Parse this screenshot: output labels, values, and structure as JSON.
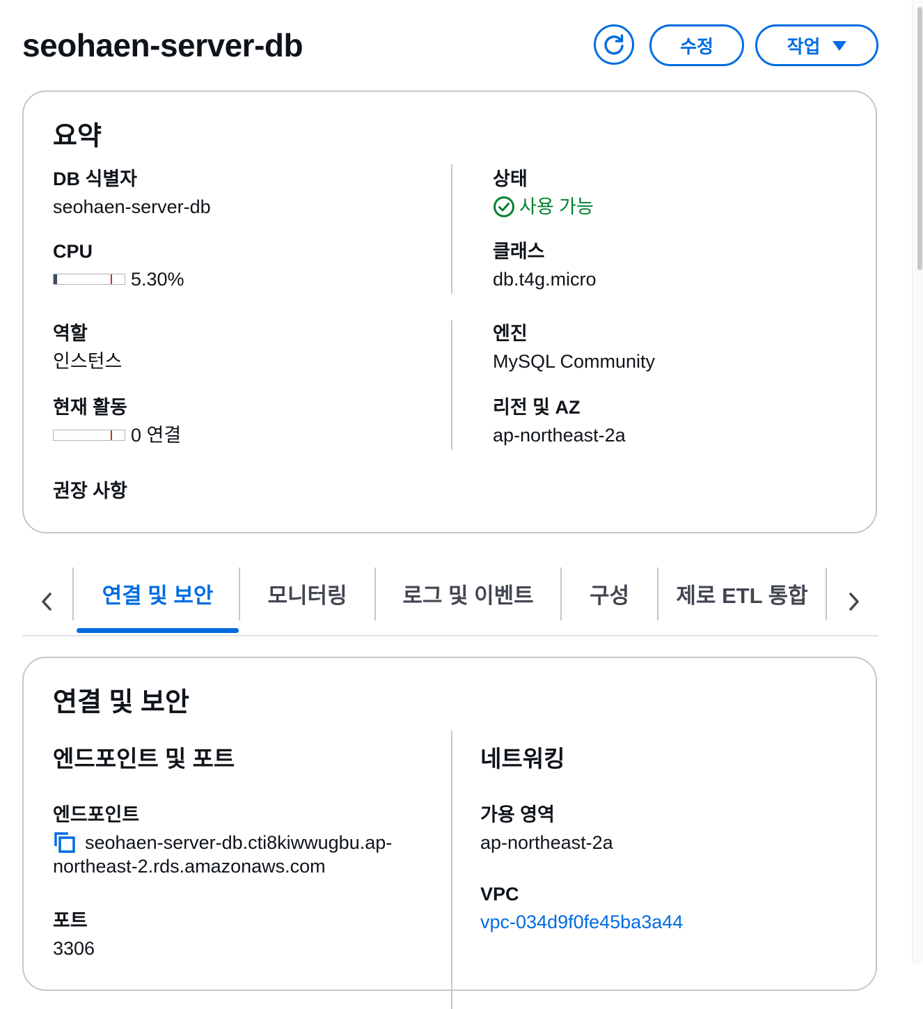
{
  "header": {
    "title": "seohaen-server-db",
    "refresh_icon": "refresh-icon",
    "edit_label": "수정",
    "actions_label": "작업",
    "accent_color": "#006ce0"
  },
  "summary": {
    "title": "요약",
    "db_identifier": {
      "label": "DB 식별자",
      "value": "seohaen-server-db"
    },
    "cpu": {
      "label": "CPU",
      "value": "5.30%",
      "fraction": 0.053
    },
    "role": {
      "label": "역할",
      "value": "인스턴스"
    },
    "activity": {
      "label": "현재 활동",
      "value": "0 연결",
      "fraction": 0
    },
    "recommendations": {
      "label": "권장 사항"
    },
    "status": {
      "label": "상태",
      "value": "사용 가능",
      "color": "#00802f",
      "icon": "check-circle-icon"
    },
    "class": {
      "label": "클래스",
      "value": "db.t4g.micro"
    },
    "engine": {
      "label": "엔진",
      "value": "MySQL Community"
    },
    "region": {
      "label": "리전 및 AZ",
      "value": "ap-northeast-2a"
    }
  },
  "tabs": {
    "items": [
      "연결 및 보안",
      "모니터링",
      "로그 및 이벤트",
      "구성",
      "제로 ETL 통합"
    ],
    "active_index": 0
  },
  "connectivity": {
    "title": "연결 및 보안",
    "endpoint_section": "엔드포인트 및 포트",
    "endpoint": {
      "label": "엔드포인트",
      "line1": "seohaen-server-db.cti8kiwwugbu.ap-",
      "line2": "northeast-2.rds.amazonaws.com",
      "icon": "copy-icon"
    },
    "port": {
      "label": "포트",
      "value": "3306"
    },
    "networking_section": "네트워킹",
    "az": {
      "label": "가용 영역",
      "value": "ap-northeast-2a"
    },
    "vpc": {
      "label": "VPC",
      "value": "vpc-034d9f0fe45ba3a44"
    }
  }
}
